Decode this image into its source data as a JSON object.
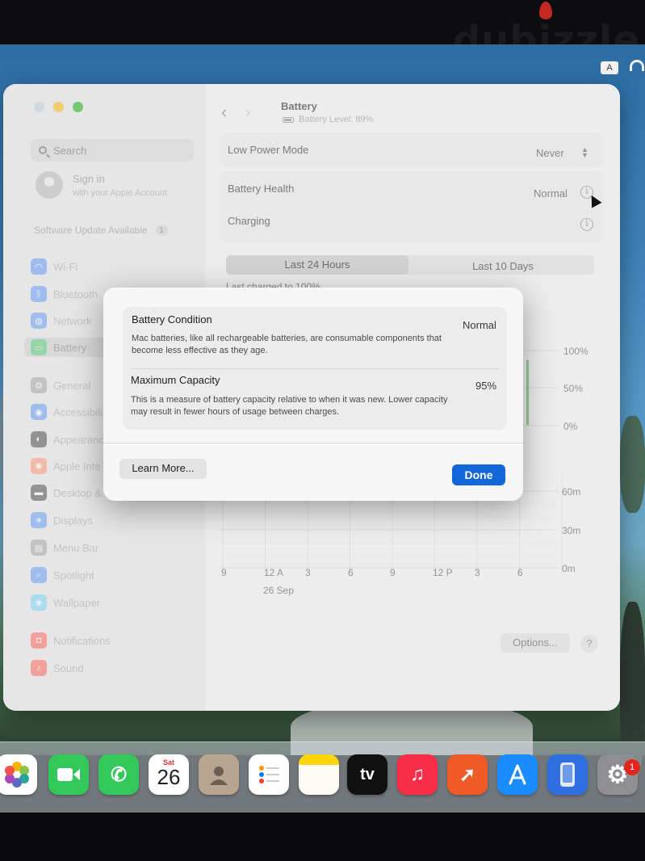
{
  "watermark": "dubizzle",
  "menubar": {
    "input_source": "A"
  },
  "sidebar": {
    "search_placeholder": "Search",
    "account_title": "Sign in",
    "account_subtitle": "with your Apple Account",
    "software_update": "Software Update Available",
    "software_update_count": "1",
    "items": [
      {
        "label": "Wi-Fi",
        "icon": "wifi-icon",
        "color": "#3b82f6"
      },
      {
        "label": "Bluetooth",
        "icon": "bluetooth-icon",
        "color": "#3b82f6"
      },
      {
        "label": "Network",
        "icon": "globe-icon",
        "color": "#3b82f6"
      },
      {
        "label": "Battery",
        "icon": "battery-icon",
        "color": "#34c759"
      },
      {
        "label": "General",
        "icon": "gear-icon",
        "color": "#8e8e93"
      },
      {
        "label": "Accessibili",
        "icon": "accessibility-icon",
        "color": "#3b82f6"
      },
      {
        "label": "Appearanc",
        "icon": "appearance-icon",
        "color": "#1c1c1e"
      },
      {
        "label": "Apple Inte",
        "icon": "apple-intelligence-icon",
        "color": "#ff7f50"
      },
      {
        "label": "Desktop & Dock",
        "icon": "dock-icon",
        "color": "#1c1c1e"
      },
      {
        "label": "Displays",
        "icon": "display-icon",
        "color": "#3b82f6"
      },
      {
        "label": "Menu Bar",
        "icon": "menubar-icon",
        "color": "#8e8e93"
      },
      {
        "label": "Spotlight",
        "icon": "spotlight-icon",
        "color": "#3b82f6"
      },
      {
        "label": "Wallpaper",
        "icon": "wallpaper-icon",
        "color": "#5ac8fa"
      },
      {
        "label": "Notifications",
        "icon": "bell-icon",
        "color": "#ff3b30"
      },
      {
        "label": "Sound",
        "icon": "speaker-icon",
        "color": "#ff3b30"
      }
    ]
  },
  "header": {
    "title": "Battery",
    "subtitle": "Battery Level: 89%"
  },
  "settings": {
    "low_power_label": "Low Power Mode",
    "low_power_value": "Never",
    "health_label": "Battery Health",
    "health_value": "Normal",
    "charging_label": "Charging"
  },
  "tabs": [
    "Last 24 Hours",
    "Last 10 Days"
  ],
  "last_charged": "Last charged to 100%",
  "chart_data": [
    {
      "type": "bar",
      "title": "",
      "ylabel": "",
      "ylim": [
        0,
        100
      ],
      "y_ticks": [
        "100%",
        "50%",
        "0%"
      ],
      "grid": true
    },
    {
      "type": "bar",
      "title": "",
      "ylabel": "",
      "ylim": [
        0,
        60
      ],
      "y_ticks": [
        "60m",
        "30m",
        "0m"
      ],
      "x_ticks": [
        "9",
        "12 A",
        "3",
        "6",
        "9",
        "12 P",
        "3",
        "6"
      ],
      "date_label": "26 Sep",
      "grid": true
    }
  ],
  "footer": {
    "options_label": "Options...",
    "help_label": "?"
  },
  "modal": {
    "condition_title": "Battery Condition",
    "condition_value": "Normal",
    "condition_desc": "Mac batteries, like all rechargeable batteries, are consumable components that become less effective as they age.",
    "capacity_title": "Maximum Capacity",
    "capacity_value": "95%",
    "capacity_desc": "This is a measure of battery capacity relative to when it was new. Lower capacity may result in fewer hours of usage between charges.",
    "learn_more": "Learn More...",
    "done": "Done"
  },
  "dock": {
    "calendar_dow": "Sat",
    "calendar_day": "26",
    "tv_label": "tv",
    "settings_badge": "1",
    "apps": [
      {
        "name": "photos-icon",
        "color": "#ffffff"
      },
      {
        "name": "facetime-icon",
        "color": "#34c759"
      },
      {
        "name": "phone-icon",
        "color": "#34c759"
      },
      {
        "name": "calendar-icon",
        "color": "#ffffff"
      },
      {
        "name": "contacts-icon",
        "color": "#b8a58f"
      },
      {
        "name": "reminders-icon",
        "color": "#ffffff"
      },
      {
        "name": "notes-icon",
        "color": "#ffd60a"
      },
      {
        "name": "apple-tv-icon",
        "color": "#111111"
      },
      {
        "name": "music-icon",
        "color": "#fa2d48"
      },
      {
        "name": "rocket-icon",
        "color": "#f05a28"
      },
      {
        "name": "app-store-icon",
        "color": "#1a8cff"
      },
      {
        "name": "iphone-mirroring-icon",
        "color": "#2f6fe0"
      },
      {
        "name": "system-settings-icon",
        "color": "#8e8e93"
      }
    ]
  }
}
